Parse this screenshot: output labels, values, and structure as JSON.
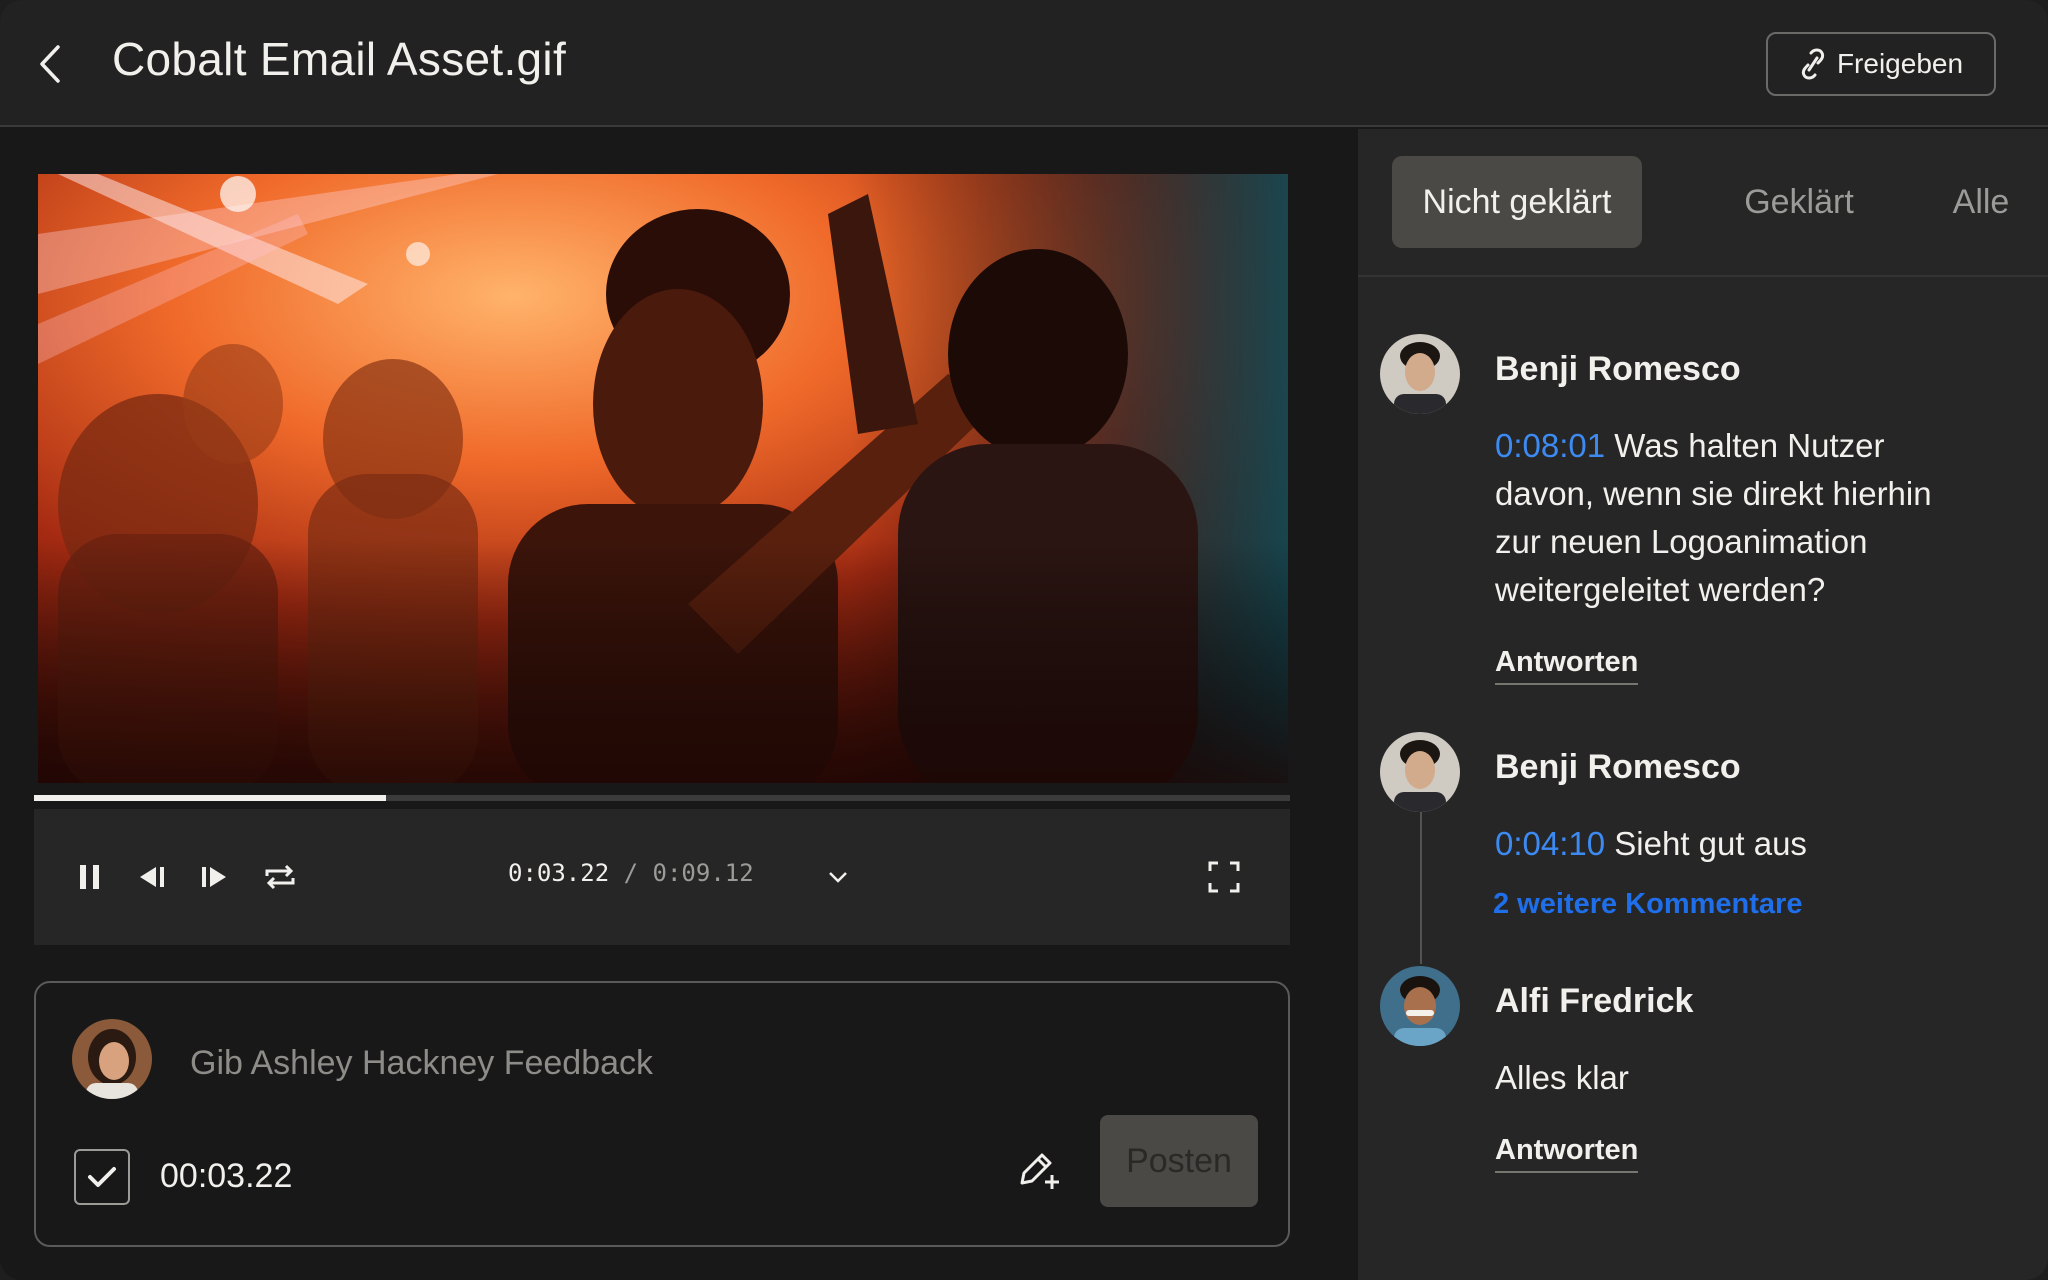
{
  "header": {
    "title": "Cobalt Email Asset.gif",
    "share_label": "Freigeben"
  },
  "player": {
    "current_time": "0:03.22",
    "separator": "/",
    "total_time": "0:09.12",
    "progress": 0.28
  },
  "composer": {
    "placeholder": "Gib Ashley Hackney Feedback",
    "timestamp": "00:03.22",
    "timestamp_checked": true,
    "post_label": "Posten"
  },
  "tabs": [
    {
      "label": "Nicht geklärt",
      "active": true
    },
    {
      "label": "Geklärt",
      "active": false
    },
    {
      "label": "Alle",
      "active": false
    }
  ],
  "comments": [
    {
      "author": "Benji Romesco",
      "time": "0:08:01",
      "text": "Was halten Nutzer davon, wenn sie direkt hierhin zur neuen Logoanimation weitergeleitet werden?",
      "reply_label": "Antworten"
    },
    {
      "author": "Benji Romesco",
      "time": "0:04:10",
      "text": "Sieht gut aus",
      "more_label": "2 weitere Kommentare"
    },
    {
      "author": "Alfi Fredrick",
      "text": "Alles klar",
      "reply_label": "Antworten"
    }
  ],
  "colors": {
    "accent_time": "#3d8bf2",
    "link_blue": "#1f6fea",
    "active_tab_bg": "#4b4946"
  }
}
